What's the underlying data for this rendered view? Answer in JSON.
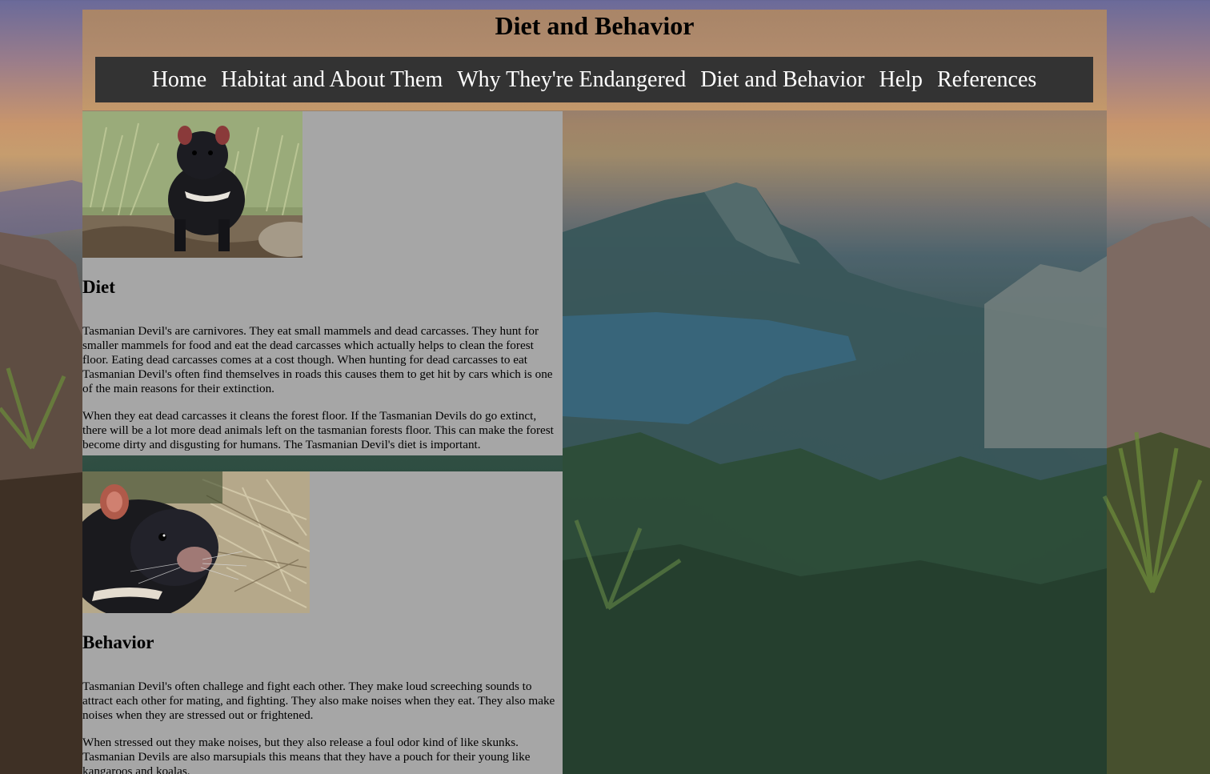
{
  "header": {
    "title": "Diet and Behavior"
  },
  "nav": {
    "items": [
      {
        "label": "Home"
      },
      {
        "label": "Habitat and About Them"
      },
      {
        "label": "Why They're Endangered"
      },
      {
        "label": "Diet and Behavior"
      },
      {
        "label": "Help"
      },
      {
        "label": "References"
      }
    ],
    "background": "#333333",
    "text_color": "#ffffff"
  },
  "sections": {
    "diet": {
      "heading": "Diet",
      "paragraphs": [
        "Tasmanian Devil's are carnivores. They eat small mammels and dead carcasses. They hunt for smaller mammels for food and eat the dead carcasses which actually helps to clean the forest floor. Eating dead carcasses comes at a cost though. When hunting for dead carcasses to eat Tasmanian Devil's often find themselves in roads this causes them to get hit by cars which is one of the main reasons for their extinction.",
        "When they eat dead carcasses it cleans the forest floor. If the Tasmanian Devils do go extinct, there will be a lot more dead animals left on the tasmanian forests floor. This can make the forest become dirty and disgusting for humans. The Tasmanian Devil's diet is important."
      ]
    },
    "behavior": {
      "heading": "Behavior",
      "paragraphs": [
        "Tasmanian Devil's often challege and fight each other. They make loud screeching sounds to attract each other for mating, and fighting. They also make noises when they eat. They also make noises when they are stressed out or frightened.",
        "When stressed out they make noises, but they also release a foul odor kind of like skunks. Tasmanian Devils are also marsupials this means that they have a pouch for their young like kangaroos and koalas."
      ]
    }
  },
  "colors": {
    "section_background": "#a6a6a6",
    "title_text": "#000000"
  }
}
